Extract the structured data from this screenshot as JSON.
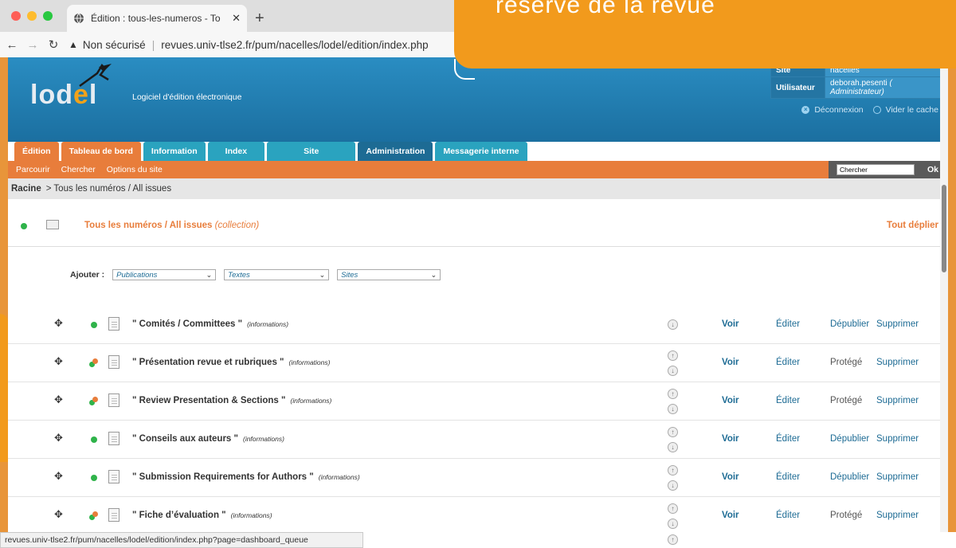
{
  "browser": {
    "tab_title": "Édition : tous-les-numeros - To",
    "new_tab": "+",
    "security_label": "Non sécurisé",
    "url": "revues.univ-tlse2.fr/pum/nacelles/lodel/edition/index.php",
    "status_url": "revues.univ-tlse2.fr/pum/nacelles/lodel/edition/index.php?page=dashboard_queue"
  },
  "callout": {
    "text": "réservé de la revue",
    "color": "#f29a1c"
  },
  "header": {
    "logo": {
      "before": "lod",
      "accent": "e",
      "after": "l"
    },
    "subtitle": "Logiciel d'édition électronique",
    "site_label": "Site",
    "site_value": "nacelles",
    "user_label": "Utilisateur",
    "user_value": "deborah.pesenti",
    "user_role": "( Administrateur)",
    "logout": "Déconnexion",
    "clear_cache": "Vider le cache"
  },
  "tabs": [
    {
      "label": "Édition",
      "color": "orange"
    },
    {
      "label": "Tableau de bord",
      "color": "orange"
    },
    {
      "label": "Information",
      "color": "teal"
    },
    {
      "label": "Index",
      "color": "teal"
    },
    {
      "label": "Site",
      "color": "teal"
    },
    {
      "label": "Administration",
      "color": "blue"
    },
    {
      "label": "Messagerie interne",
      "color": "teal"
    }
  ],
  "subnav": {
    "links": [
      "Parcourir",
      "Chercher",
      "Options du site"
    ],
    "search_value": "Chercher",
    "ok": "Ok"
  },
  "breadcrumb": {
    "root": "Racine",
    "path": "> Tous les numéros / All issues"
  },
  "collection": {
    "title": "Tous les numéros / All issues",
    "type": "(collection)",
    "expand_all": "Tout déplier"
  },
  "add": {
    "label": "Ajouter :",
    "selects": [
      "Publications",
      "Textes",
      "Sites"
    ]
  },
  "rows": [
    {
      "title": "\" Comités / Committees \"",
      "type": "(informations)",
      "status": "published",
      "up": false,
      "down": true,
      "view": "Voir",
      "edit": "Éditer",
      "publish": "Dépublier",
      "delete": "Supprimer"
    },
    {
      "title": "\" Présentation revue et rubriques \"",
      "type": "(informations)",
      "status": "protected",
      "up": true,
      "down": true,
      "view": "Voir",
      "edit": "Éditer",
      "publish": "Protégé",
      "delete": "Supprimer"
    },
    {
      "title": "\" Review Presentation & Sections \"",
      "type": "(informations)",
      "status": "protected",
      "up": true,
      "down": true,
      "view": "Voir",
      "edit": "Éditer",
      "publish": "Protégé",
      "delete": "Supprimer"
    },
    {
      "title": "\" Conseils aux auteurs \"",
      "type": "(informations)",
      "status": "published",
      "up": true,
      "down": true,
      "view": "Voir",
      "edit": "Éditer",
      "publish": "Dépublier",
      "delete": "Supprimer"
    },
    {
      "title": "\" Submission Requirements for Authors \"",
      "type": "(informations)",
      "status": "published",
      "up": true,
      "down": true,
      "view": "Voir",
      "edit": "Éditer",
      "publish": "Dépublier",
      "delete": "Supprimer"
    },
    {
      "title": "\" Fiche d’évaluation \"",
      "type": "(informations)",
      "status": "protected",
      "up": true,
      "down": true,
      "view": "Voir",
      "edit": "Éditer",
      "publish": "Protégé",
      "delete": "Supprimer"
    }
  ],
  "icons": {
    "move": "✥",
    "up": "↑",
    "down": "↓"
  }
}
